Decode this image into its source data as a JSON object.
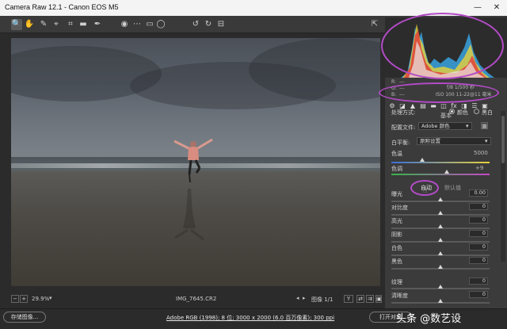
{
  "window": {
    "title": "Camera Raw 12.1  -  Canon EOS M5",
    "minimize": "—",
    "close": "✕"
  },
  "toolbar": {
    "tools": [
      "🔍",
      "✋",
      "✎",
      "⌖",
      "⌗",
      "▬",
      "✒",
      "◉",
      "⋯",
      "▭",
      "◯",
      "↺",
      "↻",
      "⊟"
    ],
    "open_prefs": "⇱"
  },
  "image": {
    "filename": "IMG_7645.CR2",
    "zoom": "29.9%",
    "image_counter": "图像 1/1",
    "y_label": "Y"
  },
  "histogram": {
    "r_label": "R:",
    "g_label": "G:",
    "b_label": "B:",
    "r_value": "---",
    "g_value": "---",
    "b_value": "---",
    "exposure_info": "f/8   1/500 秒",
    "lens_info": "ISO 100   11-22@11 毫米"
  },
  "panel": {
    "tabs": [
      "⚙",
      "◪",
      "▲",
      "▤",
      "▬",
      "◫",
      "fx",
      "◨",
      "☰",
      "▣"
    ],
    "section_title": "基本",
    "treatment_label": "处理方式:",
    "treatment_color": "颜色",
    "treatment_bw": "黑白",
    "profile_label": "配置文件:",
    "profile_value": "Adobe 颜色",
    "wb_label": "白平衡:",
    "wb_value": "原照设置",
    "temperature_label": "色温",
    "temperature_value": "5000",
    "tint_label": "色调",
    "tint_value": "+9",
    "auto_label": "自动",
    "default_label": "默认值",
    "sliders": [
      {
        "label": "曝光",
        "value": "0.00"
      },
      {
        "label": "对比度",
        "value": "0"
      },
      {
        "label": "高光",
        "value": "0"
      },
      {
        "label": "阴影",
        "value": "0"
      },
      {
        "label": "白色",
        "value": "0"
      },
      {
        "label": "黑色",
        "value": "0"
      },
      {
        "label": "纹理",
        "value": "0"
      },
      {
        "label": "清晰度",
        "value": "0"
      }
    ]
  },
  "footer": {
    "save_button": "存储图像...",
    "workflow_link": "Adobe RGB (1998); 8 位; 3000 x 2000 (6.0 百万像素); 300 ppi",
    "open_button": "打开对象",
    "watermark": "头条 @数艺设"
  },
  "colors": {
    "annotation": "#b24bc6",
    "panel_bg": "#3b3b3b",
    "titlebar_bg": "#f4f4f4"
  }
}
